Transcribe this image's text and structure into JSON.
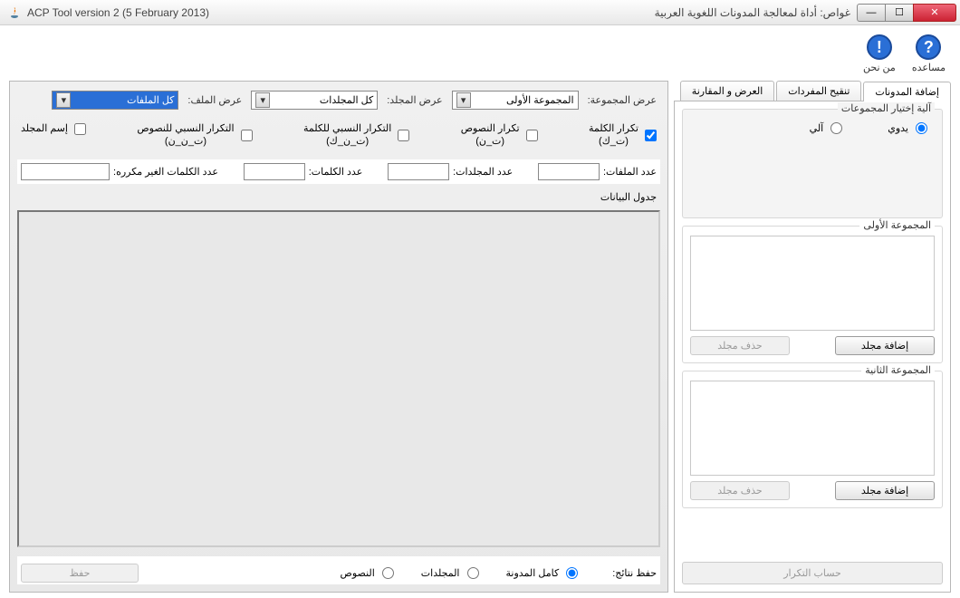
{
  "window": {
    "title_left": "ACP Tool version 2 (5 February 2013)",
    "title_right": "غواص: أداة لمعالجة المدونات اللغوية العربية"
  },
  "top_icons": {
    "help": "مساعده",
    "about": "من نحن"
  },
  "tabs": {
    "add_corpus": "إضافة المدونات",
    "vocabulary": "تنقيح المفردات",
    "compare": "العرض و المقارنة"
  },
  "group_selection": {
    "title": "آلية إختيار المجموعات",
    "manual": "يدوي",
    "auto": "آلي"
  },
  "group1": {
    "title": "المجموعة الأولى",
    "add_folder": "إضافة مجلد",
    "delete_folder": "حذف مجلد"
  },
  "group2": {
    "title": "المجموعة الثانية",
    "add_folder": "إضافة مجلد",
    "delete_folder": "حذف مجلد"
  },
  "calc_freq": "حساب التكرار",
  "dropdowns": {
    "group_label": "عرض المجموعة:",
    "group_value": "المجموعة الأولى",
    "folder_label": "عرض المجلد:",
    "folder_value": "كل المجلدات",
    "file_label": "عرض الملف:",
    "file_value": "كل الملفات"
  },
  "checkboxes": {
    "word_freq": "تكرار الكلمة\n(ت_ك)",
    "text_freq": "تكرار النصوص\n(ت_ن)",
    "word_rel_freq": "التكرار النسبي للكلمة\n(ت_ن_ك)",
    "text_rel_freq": "التكرار النسبي للنصوص\n(ت_ن_ن)",
    "folder_name": "إسم المجلد"
  },
  "stats": {
    "files": "عدد الملفات:",
    "folders": "عدد المجلدات:",
    "words": "عدد الكلمات:",
    "unique_words": "عدد الكلمات الغير مكرره:"
  },
  "data_table_label": "جدول البيانات",
  "save_results": {
    "label": "حفظ نتائج:",
    "full_corpus": "كامل المدونة",
    "folders": "المجلدات",
    "texts": "النصوص",
    "save_btn": "حفظ"
  }
}
